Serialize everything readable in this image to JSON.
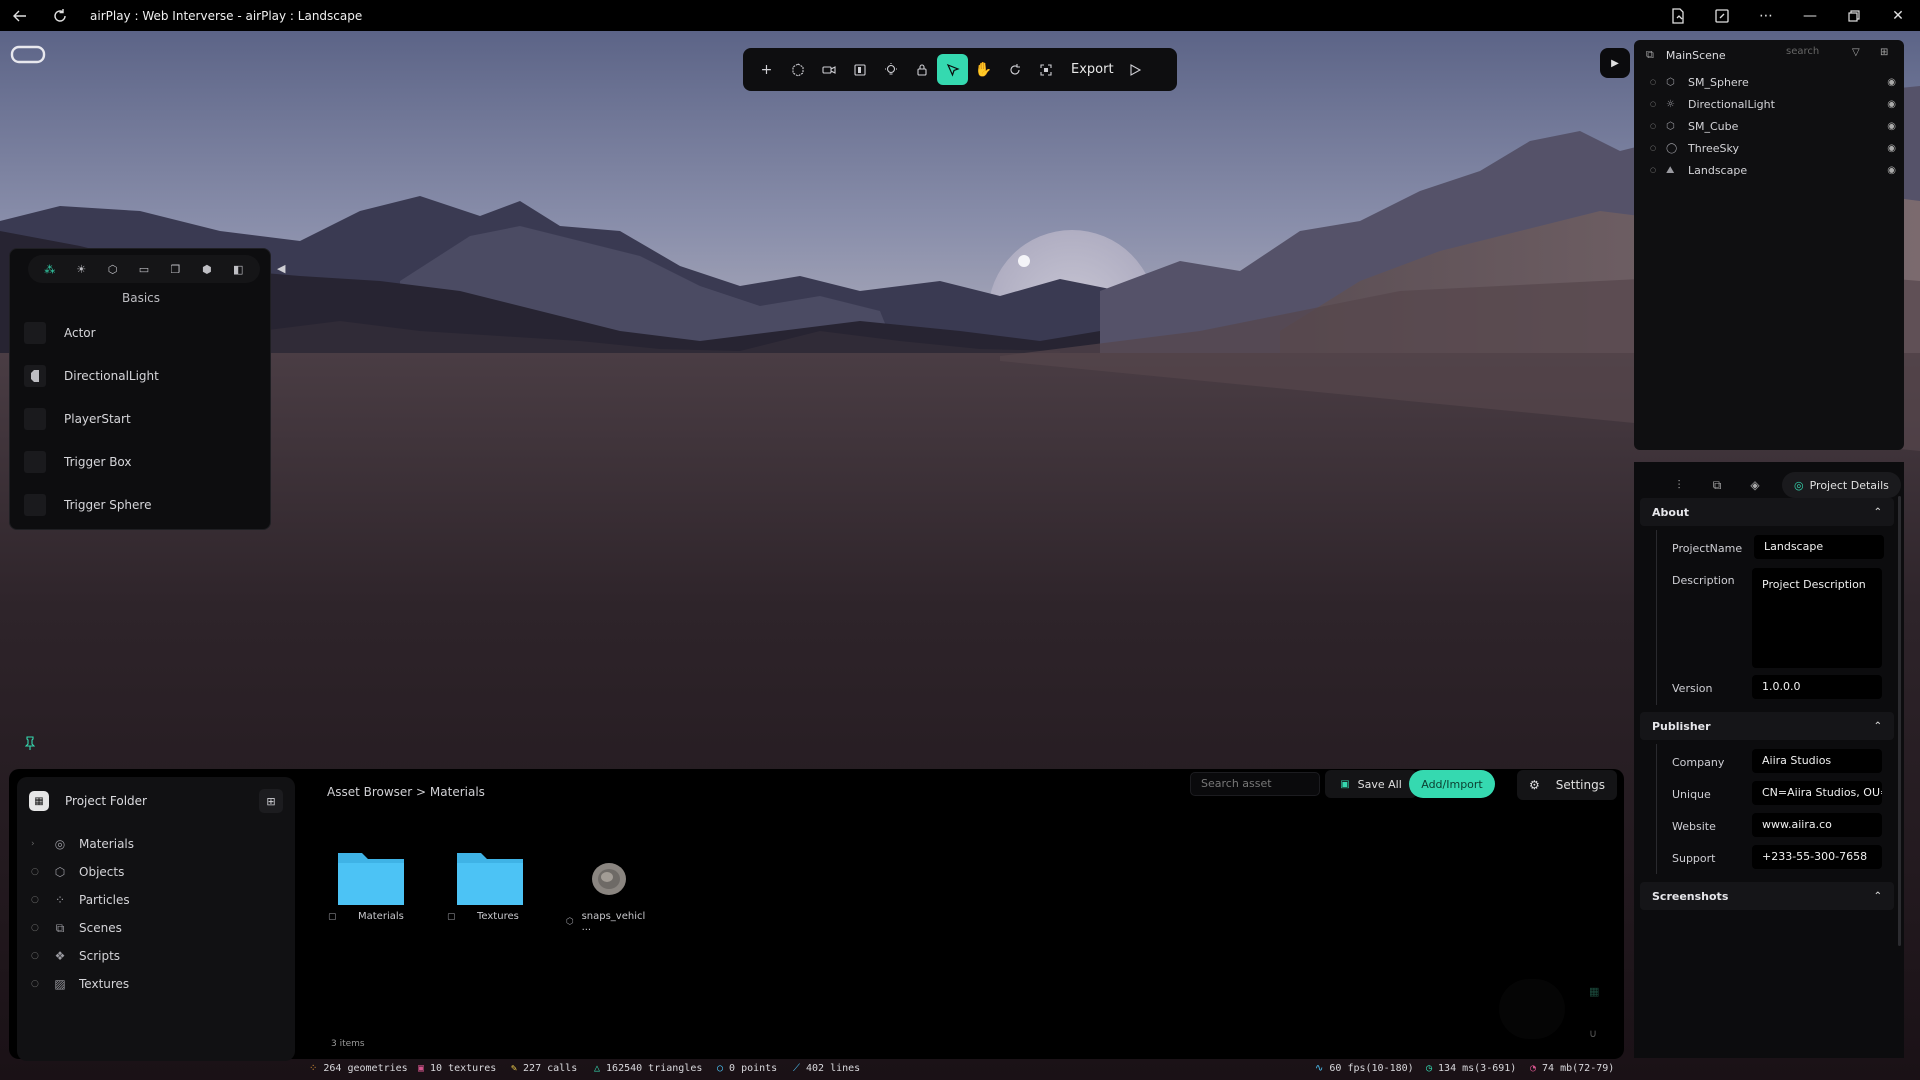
{
  "window": {
    "title": "airPlay : Web Interverse - airPlay : Landscape"
  },
  "icons": {
    "back": "back-arrow-icon",
    "refresh": "refresh-icon",
    "file": "file-icon",
    "screen": "screen-icon",
    "more": "more-dots-icon",
    "minimize": "minimize-icon",
    "restore": "restore-icon",
    "close": "close-icon"
  },
  "toolbar": {
    "export_label": "Export"
  },
  "basics": {
    "title": "Basics",
    "items": [
      {
        "label": "Actor"
      },
      {
        "label": "DirectionalLight"
      },
      {
        "label": "PlayerStart"
      },
      {
        "label": "Trigger Box"
      },
      {
        "label": "Trigger Sphere"
      }
    ]
  },
  "project_folder": {
    "title": "Project Folder",
    "items": [
      {
        "label": "Materials",
        "icon": "palette-icon"
      },
      {
        "label": "Objects",
        "icon": "cube-icon"
      },
      {
        "label": "Particles",
        "icon": "particles-icon"
      },
      {
        "label": "Scenes",
        "icon": "scenes-icon"
      },
      {
        "label": "Scripts",
        "icon": "scripts-icon"
      },
      {
        "label": "Textures",
        "icon": "image-icon"
      }
    ]
  },
  "asset_browser": {
    "breadcrumb": "Asset Browser > Materials",
    "search_placeholder": "Search asset",
    "save_all_label": "Save All",
    "add_import_label": "Add/Import",
    "settings_label": "Settings",
    "assets": [
      {
        "label": "Materials",
        "type": "folder"
      },
      {
        "label": "Textures",
        "type": "folder"
      },
      {
        "label": "snaps_vehicl ...",
        "type": "model"
      }
    ],
    "items_count": "3 items"
  },
  "status": {
    "geometries": "264 geometries",
    "textures": "10 textures",
    "calls": "227 calls",
    "triangles": "162540 triangles",
    "points": "0 points",
    "lines": "402 lines",
    "fps": "60 fps(10-180)",
    "ms": "134 ms(3-691)",
    "mb": "74 mb(72-79)"
  },
  "outliner": {
    "title": "MainScene",
    "search_placeholder": "search",
    "items": [
      {
        "label": "SM_Sphere"
      },
      {
        "label": "DirectionalLight"
      },
      {
        "label": "SM_Cube"
      },
      {
        "label": "ThreeSky"
      },
      {
        "label": "Landscape"
      }
    ]
  },
  "details": {
    "active_tab": "Project Details",
    "about": {
      "title": "About",
      "project_name_label": "ProjectName",
      "project_name": "Landscape",
      "description_label": "Description",
      "description": "Project Description",
      "version_label": "Version",
      "version": "1.0.0.0"
    },
    "publisher": {
      "title": "Publisher",
      "company_label": "Company",
      "company": "Aiira Studios",
      "unique_label": "Unique",
      "unique": "CN=Aiira Studios, OU=",
      "website_label": "Website",
      "website": "www.aiira.co",
      "support_label": "Support",
      "support": "+233-55-300-7658"
    },
    "screenshots": {
      "title": "Screenshots"
    }
  },
  "colors": {
    "accent": "#35d9b0",
    "folder": "#4cc3f5",
    "panel": "#0d0d0f",
    "hand_tool": "#f0c84a"
  }
}
